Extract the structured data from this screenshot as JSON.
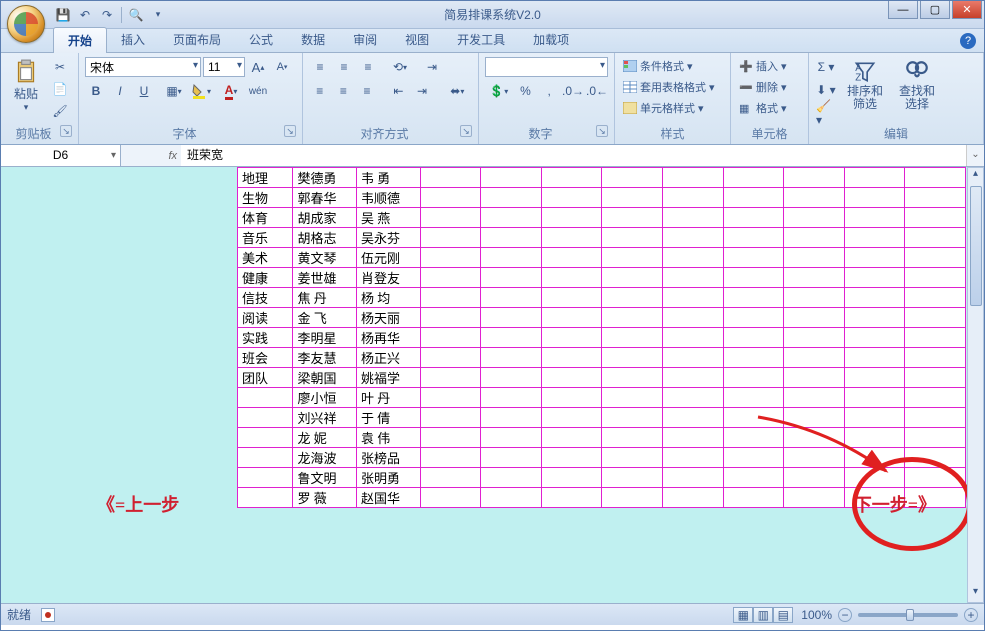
{
  "window": {
    "title": "简易排课系统V2.0"
  },
  "tabs": [
    "开始",
    "插入",
    "页面布局",
    "公式",
    "数据",
    "审阅",
    "视图",
    "开发工具",
    "加载项"
  ],
  "active_tab": 0,
  "ribbon": {
    "clipboard": {
      "label": "剪贴板",
      "paste": "粘贴"
    },
    "font": {
      "label": "字体",
      "name": "宋体",
      "size": "11"
    },
    "align": {
      "label": "对齐方式"
    },
    "number": {
      "label": "数字"
    },
    "styles": {
      "label": "样式",
      "conditional": "条件格式",
      "table": "套用表格格式",
      "cell": "单元格样式"
    },
    "cells": {
      "label": "单元格",
      "insert": "插入",
      "delete": "删除",
      "format": "格式"
    },
    "editing": {
      "label": "编辑",
      "sort": "排序和\n筛选",
      "find": "查找和\n选择"
    }
  },
  "formula": {
    "namebox": "D6",
    "fx": "fx",
    "value": "班荣宽"
  },
  "nav": {
    "prev": "《=上一步",
    "next": "下一步=》"
  },
  "grid": {
    "rows": [
      [
        "地理",
        "樊德勇",
        "韦 勇"
      ],
      [
        "生物",
        "郭春华",
        "韦顺德"
      ],
      [
        "体育",
        "胡成家",
        "吴 燕"
      ],
      [
        "音乐",
        "胡格志",
        "吴永芬"
      ],
      [
        "美术",
        "黄文琴",
        "伍元刚"
      ],
      [
        "健康",
        "姜世雄",
        "肖登友"
      ],
      [
        "信技",
        "焦 丹",
        "杨 均"
      ],
      [
        "阅读",
        "金 飞",
        "杨天丽"
      ],
      [
        "实践",
        "李明星",
        "杨再华"
      ],
      [
        "班会",
        "李友慧",
        "杨正兴"
      ],
      [
        "团队",
        "梁朝国",
        "姚福学"
      ],
      [
        "",
        "廖小恒",
        "叶 丹"
      ],
      [
        "",
        "刘兴祥",
        "于 倩"
      ],
      [
        "",
        "龙 妮",
        "袁 伟"
      ],
      [
        "",
        "龙海波",
        "张榜品"
      ],
      [
        "",
        "鲁文明",
        "张明勇"
      ],
      [
        "",
        "罗 薇",
        "赵国华"
      ]
    ],
    "blank_cols": 9
  },
  "status": {
    "ready": "就绪",
    "zoom": "100%"
  }
}
